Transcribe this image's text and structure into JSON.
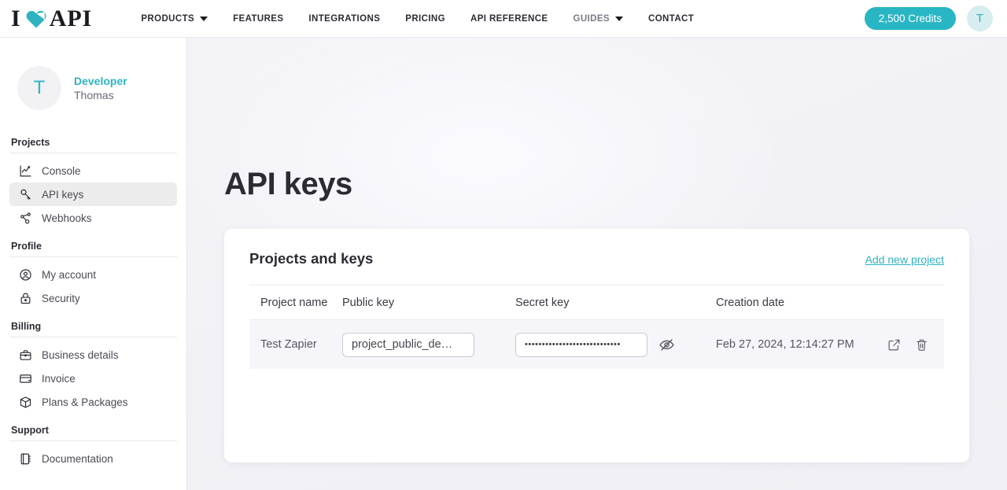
{
  "header": {
    "logo": {
      "left": "I",
      "heart_icon": "heart-icon",
      "right": "API"
    },
    "nav": [
      {
        "label": "PRODUCTS",
        "has_caret": true,
        "muted": false
      },
      {
        "label": "FEATURES",
        "has_caret": false,
        "muted": false
      },
      {
        "label": "INTEGRATIONS",
        "has_caret": false,
        "muted": false
      },
      {
        "label": "PRICING",
        "has_caret": false,
        "muted": false
      },
      {
        "label": "API REFERENCE",
        "has_caret": false,
        "muted": false
      },
      {
        "label": "GUIDES",
        "has_caret": true,
        "muted": true
      },
      {
        "label": "CONTACT",
        "has_caret": false,
        "muted": false
      }
    ],
    "credits_label": "2,500 Credits",
    "avatar_initial": "T"
  },
  "sidebar": {
    "profile": {
      "avatar_initial": "T",
      "role": "Developer",
      "name": "Thomas"
    },
    "sections": [
      {
        "title": "Projects",
        "items": [
          {
            "label": "Console",
            "icon": "chart-line-icon",
            "active": false
          },
          {
            "label": "API keys",
            "icon": "key-icon",
            "active": true
          },
          {
            "label": "Webhooks",
            "icon": "share-nodes-icon",
            "active": false
          }
        ]
      },
      {
        "title": "Profile",
        "items": [
          {
            "label": "My account",
            "icon": "account-circle-icon",
            "active": false
          },
          {
            "label": "Security",
            "icon": "lock-icon",
            "active": false
          }
        ]
      },
      {
        "title": "Billing",
        "items": [
          {
            "label": "Business details",
            "icon": "briefcase-icon",
            "active": false
          },
          {
            "label": "Invoice",
            "icon": "credit-card-icon",
            "active": false
          },
          {
            "label": "Plans & Packages",
            "icon": "package-box-icon",
            "active": false
          }
        ]
      },
      {
        "title": "Support",
        "items": [
          {
            "label": "Documentation",
            "icon": "book-icon",
            "active": false
          }
        ]
      }
    ]
  },
  "main": {
    "page_title": "API keys",
    "card": {
      "title": "Projects and keys",
      "add_link": "Add new project",
      "columns": {
        "name": "Project name",
        "public": "Public key",
        "secret": "Secret key",
        "date": "Creation date"
      },
      "rows": [
        {
          "project_name": "Test Zapier",
          "public_key": "project_public_de…",
          "secret_key_masked": "••••••••••••••••••••••••••••",
          "creation_date": "Feb 27, 2024, 12:14:27 PM",
          "toggle_secret_icon": "eye-off-icon",
          "edit_icon": "edit-square-icon",
          "delete_icon": "trash-icon"
        }
      ]
    }
  },
  "colors": {
    "accent_teal": "#2fb3c0",
    "badge_teal": "#29b6c4",
    "page_bg": "#f1f1f6",
    "card_bg": "#ffffff",
    "row_bg": "#f6f6fa"
  }
}
